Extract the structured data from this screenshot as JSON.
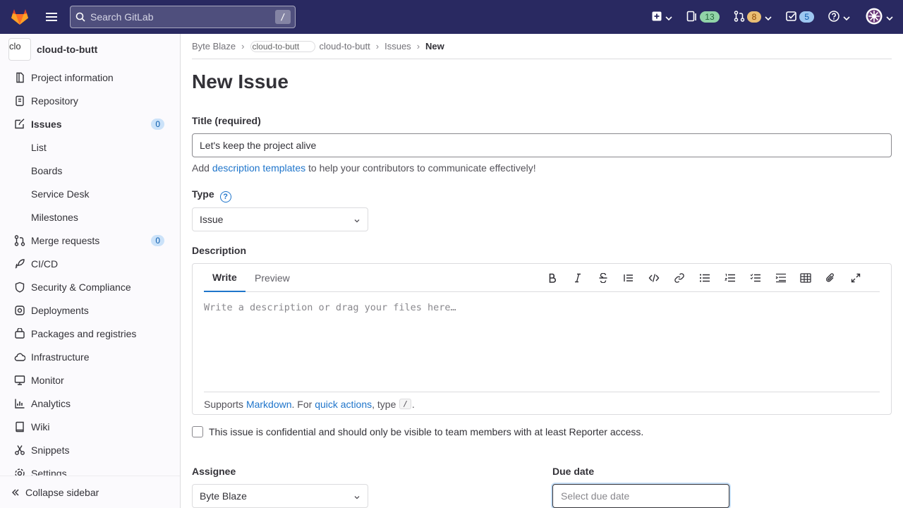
{
  "topbar": {
    "search_placeholder": "Search GitLab",
    "search_shortcut": "/",
    "issues_count": "13",
    "mr_count": "8",
    "todos_count": "5"
  },
  "sidebar": {
    "project_name": "cloud-to-butt",
    "avatar_alt": "clo",
    "items": [
      {
        "label": "Project information",
        "icon": "info-icon"
      },
      {
        "label": "Repository",
        "icon": "document-icon"
      },
      {
        "label": "Issues",
        "icon": "issues-icon",
        "count": "0"
      },
      {
        "label": "List"
      },
      {
        "label": "Boards"
      },
      {
        "label": "Service Desk"
      },
      {
        "label": "Milestones"
      },
      {
        "label": "Merge requests",
        "icon": "merge-request-icon",
        "count": "0"
      },
      {
        "label": "CI/CD",
        "icon": "rocket-icon"
      },
      {
        "label": "Security & Compliance",
        "icon": "shield-icon"
      },
      {
        "label": "Deployments",
        "icon": "deployments-icon"
      },
      {
        "label": "Packages and registries",
        "icon": "package-icon"
      },
      {
        "label": "Infrastructure",
        "icon": "cloud-icon"
      },
      {
        "label": "Monitor",
        "icon": "monitor-icon"
      },
      {
        "label": "Analytics",
        "icon": "chart-icon"
      },
      {
        "label": "Wiki",
        "icon": "book-icon"
      },
      {
        "label": "Snippets",
        "icon": "scissors-icon"
      },
      {
        "label": "Settings",
        "icon": "settings-icon"
      }
    ],
    "collapse_label": "Collapse sidebar"
  },
  "breadcrumb": {
    "group": "Byte Blaze",
    "project_img_alt": "cloud-to-butt",
    "project": "cloud-to-butt",
    "section": "Issues",
    "current": "New"
  },
  "form": {
    "page_title": "New Issue",
    "title_label": "Title (required)",
    "title_value": "Let's keep the project alive",
    "helper_prefix": "Add",
    "helper_link": "description templates",
    "helper_suffix": "to help your contributors to communicate effectively!",
    "type_label": "Type",
    "type_value": "Issue",
    "description_label": "Description",
    "tab_write": "Write",
    "tab_preview": "Preview",
    "description_placeholder": "Write a description or drag your files here…",
    "footer_supports": "Supports",
    "footer_markdown": "Markdown",
    "footer_for": ". For",
    "footer_quick_actions": "quick actions",
    "footer_type": ", type",
    "footer_slash": "/",
    "footer_end": ".",
    "confidential_text": "This issue is confidential and should only be visible to team members with at least Reporter access.",
    "assignee_label": "Assignee",
    "assignee_value": "Byte Blaze",
    "due_date_label": "Due date",
    "due_date_placeholder": "Select due date"
  }
}
